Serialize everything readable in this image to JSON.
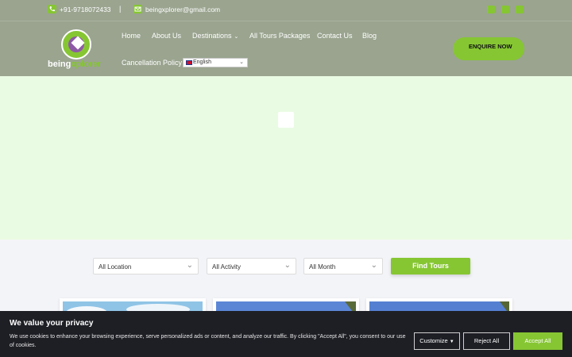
{
  "topbar": {
    "phone": "+91-9718072433",
    "separator": "|",
    "email": "beingxplorer@gmail.com",
    "social_icons": [
      "facebook-icon",
      "instagram-icon",
      "youtube-icon"
    ]
  },
  "brand": {
    "logo_text_a": "being",
    "logo_text_b": "xplorer"
  },
  "nav": {
    "items": [
      "Home",
      "About Us",
      "Destinations",
      "All Tours Packages",
      "Contact Us",
      "Blog",
      "Cancellation Policy"
    ],
    "destinations_caret": "⌄",
    "language": "English",
    "enquire_label": "ENQUIRE NOW"
  },
  "search": {
    "location": "All Location",
    "activity": "All Activity",
    "month": "All Month",
    "chevron": "⌄",
    "find_label": "Find Tours"
  },
  "cookie": {
    "title": "We value your privacy",
    "text": "We use cookies to enhance your browsing experience, serve personalized ads or content, and analyze our traffic. By clicking \"Accept All\", you consent to our use of cookies.",
    "customize_label": "Customize",
    "reject_label": "Reject All",
    "accept_label": "Accept All"
  },
  "colors": {
    "accent": "#86c633",
    "header_bg": "#9aa48f",
    "hero_bg": "#eafbe3",
    "cookie_bg": "#1e1f25"
  }
}
